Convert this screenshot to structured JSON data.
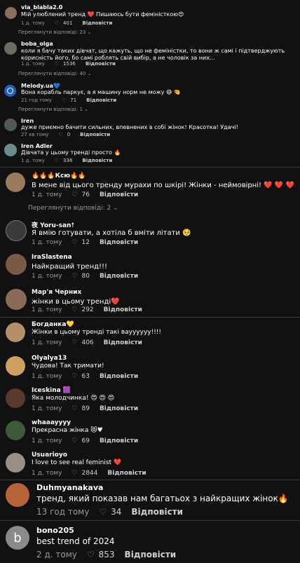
{
  "sections": [
    {
      "comments": [
        {
          "author": "vla_blabla2.0",
          "text": "Мій улюблений тренд ❤️ Пишаюсь бути феміністкою😍",
          "date": "1 д. тому",
          "likes": "401",
          "reply": "Відповісти",
          "avatar_color": "#8a6f5a"
        },
        {
          "more": "Переглянути відповіді: 23 ⌄"
        },
        {
          "author": "boba_olga",
          "text": "коли я бачу таких дівчат, що кажуть, що не феміністки, то вони ж самі і підтверджують корисність його, бо самі роблять свій вибір, а не чоловік за них...",
          "date": "1 д. тому",
          "likes": "1536",
          "reply": "Відповісти",
          "avatar_color": "#6d6a63"
        },
        {
          "more": "Переглянути відповіді: 40 ⌄"
        },
        {
          "author": "Melody.ua💙",
          "text": "Вона корабль паркує, а я машину норм не можу 😅 🤏",
          "date": "21 год тому",
          "likes": "71",
          "reply": "Відповісти",
          "avatar_color": "#1f5fbf"
        },
        {
          "more": "Переглянути відповіді: 1 ⌄"
        },
        {
          "author": "Iren",
          "text": "дуже приємно бачити сильних, впевнених в собі жінок! Красотка! Удачі!",
          "date": "27 хв тому",
          "likes": "0",
          "reply": "Відповісти",
          "avatar_color": "#4f5a57"
        },
        {
          "author": "Iren Adler",
          "text": "Дівчата у цьому тренді просто 🔥",
          "date": "1 д. тому",
          "likes": "336",
          "reply": "Відповісти",
          "avatar_color": "#6c8b8e"
        }
      ]
    },
    {
      "comments": [
        {
          "author": "🔥🔥🔥Ксю🔥🔥",
          "text": "В мене від цього тренду мурахи по шкірі! Жінки - неймовірні! ❤️ ❤️ ❤️",
          "date": "1 д. тому",
          "likes": "76",
          "reply": "Відповісти",
          "avatar_color": "#9c7a5e"
        },
        {
          "more": "Переглянути відповіді: 2 ⌄"
        },
        {
          "author": "夜 Yoru-san☨",
          "text": "Я вмію готувати, а хотіла б вміти літати 🥺",
          "date": "1 д. тому",
          "likes": "12",
          "reply": "Відповісти",
          "avatar_color": "#3a3a3a"
        },
        {
          "author": "IraSlastena",
          "text": "Найкращий тренд!!!",
          "date": "1 д. тому",
          "likes": "80",
          "reply": "Відповісти",
          "avatar_color": "#7a5a46"
        },
        {
          "author": "Мар'я Черних",
          "text": "жінки в цьому тренді❤️",
          "date": "1 д. тому",
          "likes": "292",
          "reply": "Відповісти",
          "avatar_color": "#8a6a58"
        }
      ]
    },
    {
      "comments": [
        {
          "author": "Богданка💛",
          "text": "Жінки в цьому тренді такі вауууууу!!!!",
          "date": "1 д. тому",
          "likes": "406",
          "reply": "Відповісти",
          "avatar_color": "#b58f6a"
        },
        {
          "author": "Olyalya13",
          "text": "Чудова! Так тримати!",
          "date": "1 д. тому",
          "likes": "63",
          "reply": "Відповісти",
          "avatar_color": "#d0a060"
        },
        {
          "author": "Iceskina 🟪",
          "text": "Яка молодчинка! 😍 😍 😍",
          "date": "1 д. тому",
          "likes": "89",
          "reply": "Відповісти",
          "avatar_color": "#5a3a2e"
        },
        {
          "author": "whaaayyyy",
          "text": "Прекрасна жінка 😻♥",
          "date": "1 д. тому",
          "likes": "69",
          "reply": "Відповісти",
          "avatar_color": "#3d5a3a"
        },
        {
          "author": "Usuarioyo",
          "text": "I love to see real feminist ❤️",
          "date": "1 д. тому",
          "likes": "2844",
          "reply": "Відповісти",
          "avatar_color": "#9a8f86"
        }
      ]
    },
    {
      "comments": [
        {
          "author": "Duhmyanakava",
          "text": "тренд, який показав нам багатьох з найкращих жінок🔥",
          "date": "13 год тому",
          "likes": "34",
          "reply": "Відповісти",
          "avatar_color": "#b8623a"
        },
        {
          "author": "bono205",
          "text": "best trend of 2024",
          "date": "2 д. тому",
          "likes": "853",
          "reply": "Відповісти",
          "avatar_color": "#8a8a8a",
          "avatar_letter": "b"
        }
      ]
    }
  ],
  "colors": {
    "background": "#111111",
    "meta": "#9a9a9a",
    "divider": "#3a3a3a"
  }
}
